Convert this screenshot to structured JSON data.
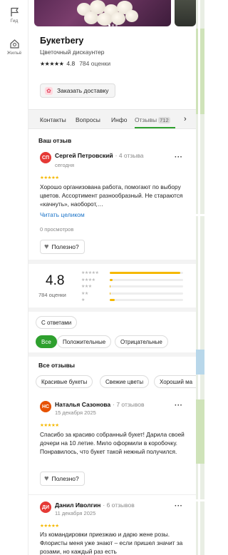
{
  "rail": {
    "items": [
      {
        "label": "Гид",
        "icon": "flag-icon"
      },
      {
        "label": "Жильё",
        "icon": "house-icon"
      }
    ]
  },
  "place": {
    "title": "Букетbery",
    "category": "Цветочный дискаунтер",
    "stars": "★★★★★",
    "rating": "4.8",
    "rating_count": "784 оценки",
    "order_button": "Заказать доставку"
  },
  "tabs": {
    "items": [
      "Контакты",
      "Вопросы",
      "Инфо",
      "Отзывы"
    ],
    "reviews_count": "712",
    "more": "›"
  },
  "my_review": {
    "section_title": "Ваш отзыв",
    "avatar": "СП",
    "avatar_color": "#e53935",
    "name": "Сергей Петровский",
    "count": "· 4 отзыва",
    "date": "сегодня",
    "stars": "★★★★★",
    "text": "Хорошо организована работа, помогают по выбору цветов. Ассортимент разнообразный. Не стараются «качнуть», наоборот,…",
    "read_more": "Читать целиком",
    "views": "0 просмотров",
    "useful": "Полезно?"
  },
  "summary": {
    "rating": "4.8",
    "count": "784 оценки",
    "bars": [
      {
        "stars": "★★★★★",
        "fraction": 0.96
      },
      {
        "stars": "★★★★",
        "fraction": 0.04
      },
      {
        "stars": "★★★",
        "fraction": 0.01
      },
      {
        "stars": "★★",
        "fraction": 0.01
      },
      {
        "stars": "★",
        "fraction": 0.07
      }
    ]
  },
  "filters": {
    "with_answers": "С ответами",
    "all": "Все",
    "positive": "Положительные",
    "negative": "Отрицательные"
  },
  "all_reviews": {
    "section_title": "Все отзывы",
    "tags": [
      "Красивые букеты",
      "Свежие цветы",
      "Хороший ма"
    ]
  },
  "reviews": [
    {
      "avatar": "НС",
      "avatar_color": "#e65100",
      "name": "Наталья Сазонова",
      "count": "· 7 отзывов",
      "date": "15 декабря 2025",
      "stars": "★★★★★",
      "text": "Спасибо за красиво собранный букет! Дарила своей дочери на 10 летие. Мило оформили в коробочку. Понравилось, что букет такой нежный получился.",
      "useful": "Полезно?"
    },
    {
      "avatar": "ДИ",
      "avatar_color": "#e53935",
      "name": "Данил Иволгин",
      "count": "· 6 отзывов",
      "date": "11 декабря 2025",
      "stars": "★★★★★",
      "text": "Из командировки приезжаю и дарю жене розы. Флористы меня уже знают – если пришел значит за розами, но каждый раз есть"
    }
  ],
  "colors": {
    "accent": "#2ea02e",
    "star": "#f5b800",
    "link": "#1a73c8"
  }
}
